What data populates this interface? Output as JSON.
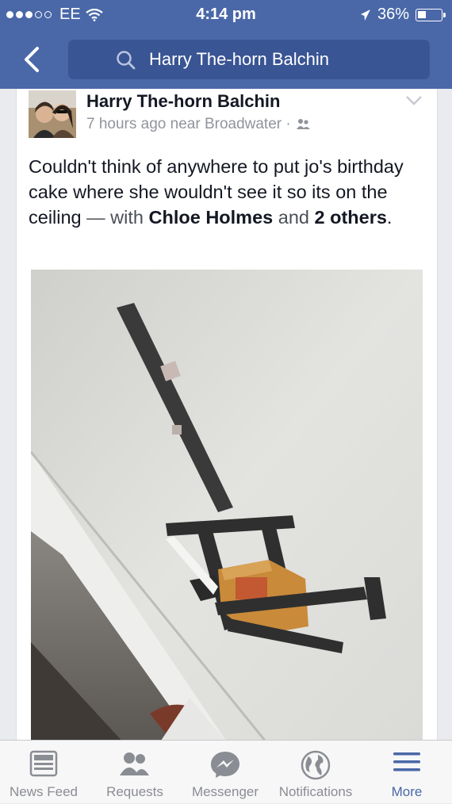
{
  "status_bar": {
    "carrier": "EE",
    "time": "4:14 pm",
    "battery_percent": "36%",
    "battery_level": 0.36,
    "signal_bars_filled": 3,
    "signal_bars_total": 5
  },
  "nav": {
    "back_icon": "chevron-left-icon",
    "search_icon": "search-icon",
    "search_text": "Harry The-horn Balchin"
  },
  "post": {
    "author": "Harry The-horn Balchin",
    "time_location": "7 hours ago near Broadwater ·",
    "privacy_icon": "friends-icon",
    "text_main": "Couldn't think of anywhere to put jo's birthday cake where she wouldn't see it so its on the ceiling",
    "text_with": " — with ",
    "tagged_person": "Chloe Holmes",
    "text_and": " and ",
    "tagged_others": "2 others",
    "text_end": "."
  },
  "tabbar": {
    "items": [
      {
        "label": "News Feed",
        "icon": "news-feed-icon",
        "active": false
      },
      {
        "label": "Requests",
        "icon": "friend-requests-icon",
        "active": false
      },
      {
        "label": "Messenger",
        "icon": "messenger-icon",
        "active": false
      },
      {
        "label": "Notifications",
        "icon": "globe-icon",
        "active": false
      },
      {
        "label": "More",
        "icon": "menu-icon",
        "active": true
      }
    ]
  },
  "colors": {
    "header": "#4a68a8",
    "search_box": "#3a5594",
    "tab_inactive": "#8a8d93",
    "tab_active": "#4a68a8"
  }
}
